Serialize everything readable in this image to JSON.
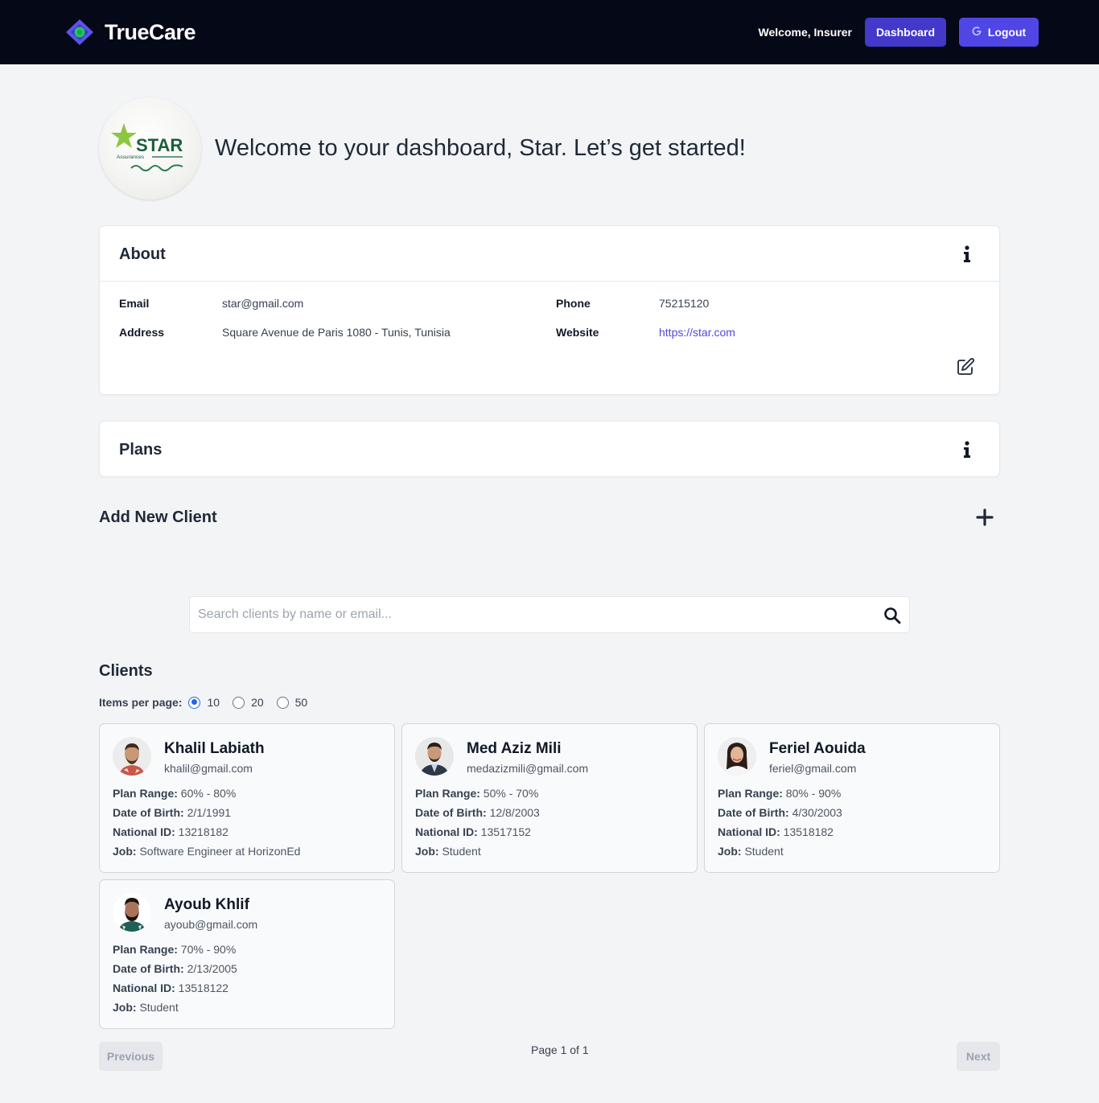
{
  "header": {
    "brand": "TrueCare",
    "welcome": "Welcome, Insurer",
    "dashboard_label": "Dashboard",
    "logout_label": "Logout"
  },
  "profile": {
    "welcome_title": "Welcome to your dashboard, Star. Let’s get started!",
    "logo_text": "STAR",
    "logo_subtext": "Assurances"
  },
  "about": {
    "title": "About",
    "email_label": "Email",
    "email": "star@gmail.com",
    "address_label": "Address",
    "address": "Square Avenue de Paris 1080 - Tunis, Tunisia",
    "phone_label": "Phone",
    "phone": "75215120",
    "website_label": "Website",
    "website": "https://star.com"
  },
  "plans": {
    "title": "Plans"
  },
  "add_client": {
    "title": "Add New Client"
  },
  "search": {
    "placeholder": "Search clients by name or email..."
  },
  "clients": {
    "title": "Clients",
    "per_page_label": "Items per page:",
    "per_page_options": [
      "10",
      "20",
      "50"
    ],
    "selected_per_page": "10",
    "list": [
      {
        "name": "Khalil Labiath",
        "email": "khalil@gmail.com",
        "plan_label": "Plan Range:",
        "plan": "60% - 80%",
        "dob_label": "Date of Birth:",
        "dob": "2/1/1991",
        "nid_label": "National ID:",
        "nid": "13218182",
        "job_label": "Job:",
        "job": "Software Engineer at HorizonEd"
      },
      {
        "name": "Med Aziz Mili",
        "email": "medazizmili@gmail.com",
        "plan_label": "Plan Range:",
        "plan": "50% - 70%",
        "dob_label": "Date of Birth:",
        "dob": "12/8/2003",
        "nid_label": "National ID:",
        "nid": "13517152",
        "job_label": "Job:",
        "job": "Student"
      },
      {
        "name": "Feriel Aouida",
        "email": "feriel@gmail.com",
        "plan_label": "Plan Range:",
        "plan": "80% - 90%",
        "dob_label": "Date of Birth:",
        "dob": "4/30/2003",
        "nid_label": "National ID:",
        "nid": "13518182",
        "job_label": "Job:",
        "job": "Student"
      },
      {
        "name": "Ayoub Khlif",
        "email": "ayoub@gmail.com",
        "plan_label": "Plan Range:",
        "plan": "70% - 90%",
        "dob_label": "Date of Birth:",
        "dob": "2/13/2005",
        "nid_label": "National ID:",
        "nid": "13518122",
        "job_label": "Job:",
        "job": "Student"
      }
    ]
  },
  "pagination": {
    "previous_label": "Previous",
    "page_info": "Page 1 of 1",
    "next_label": "Next"
  },
  "colors": {
    "header_bg": "#050816",
    "primary": "#4f46e5",
    "primary_dark": "#4338ca",
    "brand_accent": "#22c55e",
    "page_bg": "#f3f4f6"
  }
}
